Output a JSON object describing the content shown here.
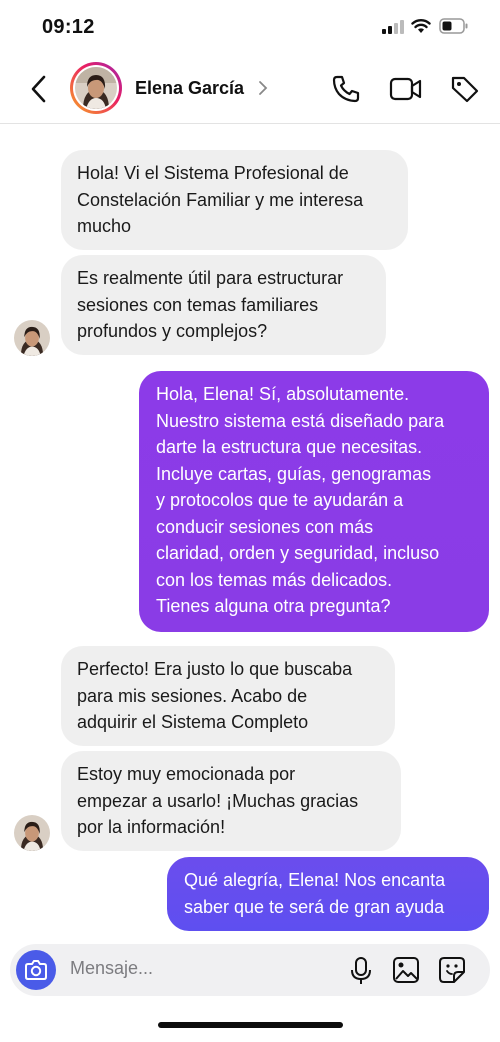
{
  "status_bar": {
    "time": "09:12"
  },
  "header": {
    "contact_name": "Elena García"
  },
  "messages": [
    {
      "from": "contact",
      "lines": [
        "Hola! Vi el Sistema Profesional de",
        "Constelación Familiar y me interesa",
        "mucho"
      ]
    },
    {
      "from": "contact",
      "lines": [
        "Es realmente útil para estructurar",
        "sesiones con temas familiares",
        "profundos y complejos?"
      ]
    },
    {
      "from": "me",
      "lines": [
        "Hola, Elena! Sí, absolutamente.",
        "Nuestro sistema está diseñado para",
        "darte la estructura que necesitas.",
        "Incluye cartas, guías, genogramas",
        "y protocolos que te ayudarán a",
        "conducir sesiones con más",
        "claridad, orden y seguridad, incluso",
        "con los temas más delicados.",
        "Tienes alguna otra pregunta?"
      ]
    },
    {
      "from": "contact",
      "lines": [
        "Perfecto! Era justo lo que buscaba",
        "para mis sesiones. Acabo de",
        "adquirir el Sistema Completo"
      ]
    },
    {
      "from": "contact",
      "lines": [
        "Estoy muy emocionada por",
        "empezar a usarlo! ¡Muchas gracias",
        "por la información!"
      ]
    },
    {
      "from": "me",
      "lines": [
        "Qué alegría, Elena! Nos encanta",
        "saber que te será de gran ayuda"
      ]
    }
  ],
  "composer": {
    "placeholder": "Mensaje..."
  },
  "colors": {
    "outgoing_bubble": "#8a3ce6",
    "outgoing_bubble_last": "#6150ef",
    "incoming_bubble": "#efefef",
    "camera_button": "#4a5be8"
  },
  "icons": [
    "back-chevron-icon",
    "phone-icon",
    "video-camera-icon",
    "tag-icon",
    "camera-icon",
    "microphone-icon",
    "image-icon",
    "sticker-icon"
  ]
}
